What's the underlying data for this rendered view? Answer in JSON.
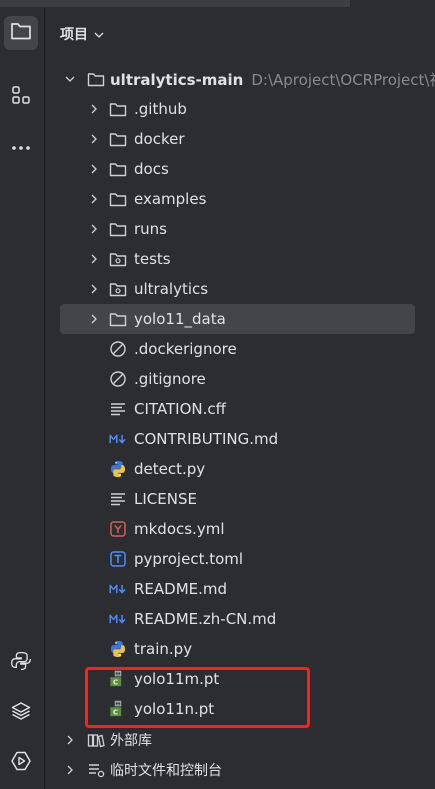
{
  "panel": {
    "title": "项目",
    "root": {
      "label": "ultralytics-main",
      "path": "D:\\Aproject\\OCRProject\\视"
    },
    "items": [
      {
        "label": ".github",
        "kind": "folder"
      },
      {
        "label": "docker",
        "kind": "folder"
      },
      {
        "label": "docs",
        "kind": "folder"
      },
      {
        "label": "examples",
        "kind": "folder"
      },
      {
        "label": "runs",
        "kind": "folder"
      },
      {
        "label": "tests",
        "kind": "package"
      },
      {
        "label": "ultralytics",
        "kind": "package"
      },
      {
        "label": "yolo11_data",
        "kind": "folder",
        "selected": true
      },
      {
        "label": ".dockerignore",
        "kind": "ignore"
      },
      {
        "label": ".gitignore",
        "kind": "ignore"
      },
      {
        "label": "CITATION.cff",
        "kind": "text"
      },
      {
        "label": "CONTRIBUTING.md",
        "kind": "markdown"
      },
      {
        "label": "detect.py",
        "kind": "python"
      },
      {
        "label": "LICENSE",
        "kind": "text"
      },
      {
        "label": "mkdocs.yml",
        "kind": "yaml"
      },
      {
        "label": "pyproject.toml",
        "kind": "toml"
      },
      {
        "label": "README.md",
        "kind": "markdown"
      },
      {
        "label": "README.zh-CN.md",
        "kind": "markdown"
      },
      {
        "label": "train.py",
        "kind": "python"
      },
      {
        "label": "yolo11m.pt",
        "kind": "pt"
      },
      {
        "label": "yolo11n.pt",
        "kind": "pt"
      }
    ],
    "external_libraries": "外部库",
    "scratches": "临时文件和控制台"
  },
  "activity_bar": {
    "top": [
      "folder-icon",
      "structure-icon",
      "more-icon"
    ],
    "bottom": [
      "python-console-icon",
      "layers-icon",
      "services-icon"
    ]
  },
  "colors": {
    "background": "#2b2d30",
    "selection": "#43454a",
    "text": "#dfe1e5",
    "muted": "#868a91",
    "highlight_box": "#ff1f1f",
    "markdown_blue": "#4e8df6",
    "yaml_red": "#d75d5d",
    "pt_green": "#5c8f3e"
  }
}
